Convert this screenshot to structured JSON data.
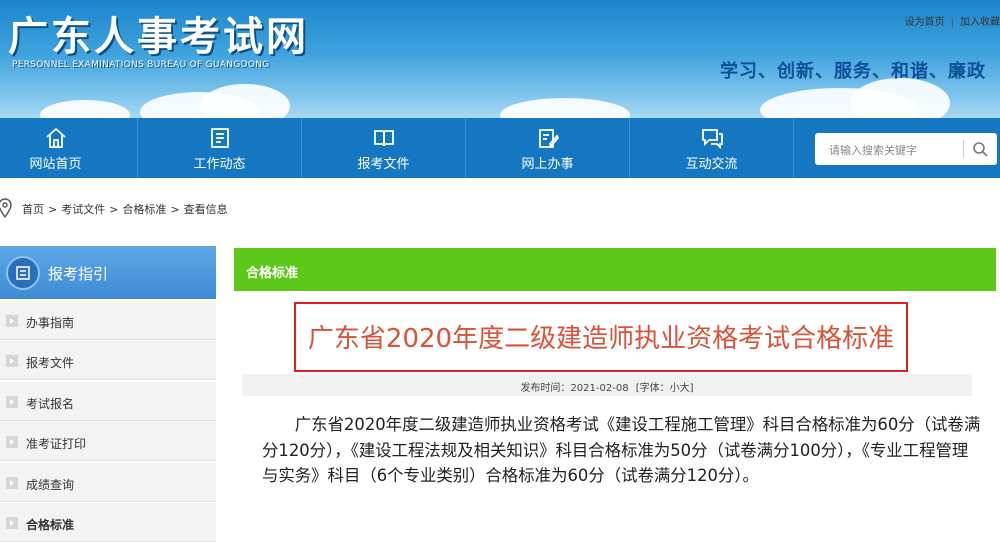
{
  "header": {
    "site_title": "广东人事考试网",
    "site_subtitle": "PERSONNEL EXAMINATIONS BUREAU OF GUANGDONG",
    "top_links": [
      "设为首页",
      "加入收藏"
    ],
    "slogan": "学习、创新、服务、和谐、廉政"
  },
  "nav": {
    "items": [
      {
        "label": "网站首页",
        "icon": "home-icon"
      },
      {
        "label": "工作动态",
        "icon": "news-icon"
      },
      {
        "label": "报考文件",
        "icon": "book-icon"
      },
      {
        "label": "网上办事",
        "icon": "edit-form-icon"
      },
      {
        "label": "互动交流",
        "icon": "chat-icon"
      }
    ],
    "search_placeholder": "请输入搜索关键字"
  },
  "breadcrumb": [
    "首页",
    ">",
    "考试文件",
    ">",
    "合格标准",
    ">",
    "查看信息"
  ],
  "sidebar": {
    "title": "报考指引",
    "items": [
      {
        "label": "办事指南"
      },
      {
        "label": "报考文件"
      },
      {
        "label": "考试报名"
      },
      {
        "label": "准考证打印"
      },
      {
        "label": "成绩查询"
      },
      {
        "label": "合格标准"
      }
    ]
  },
  "content": {
    "section_title": "合格标准",
    "article_title": "广东省2020年度二级建造师执业资格考试合格标准",
    "publish_label": "发布时间：",
    "publish_date": "2021-02-08",
    "font_size_label": "[字体：小大]",
    "body": "广东省2020年度二级建造师执业资格考试《建设工程施工管理》科目合格标准为60分（试卷满分120分），《建设工程法规及相关知识》科目合格标准为50分（试卷满分100分），《专业工程管理与实务》科目（6个专业类别）合格标准为60分（试卷满分120分）。"
  },
  "colors": {
    "nav_bg": "#1577c1",
    "section_bar": "#5ec81a",
    "title_red": "#d9533a",
    "highlight_border": "#e02020"
  }
}
